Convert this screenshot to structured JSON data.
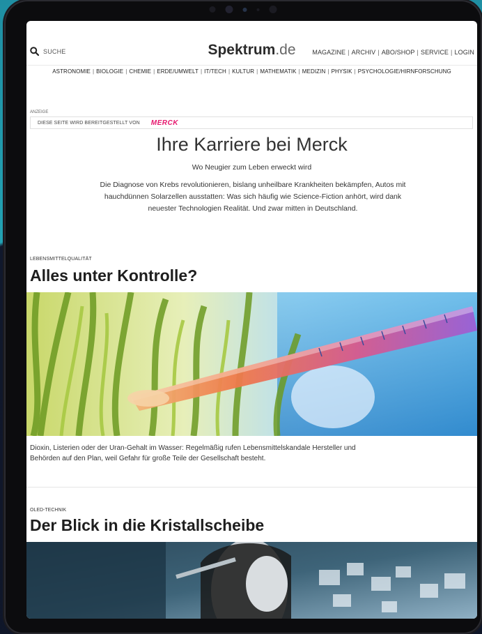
{
  "header": {
    "search_label": "SUCHE",
    "logo_main": "Spektrum",
    "logo_suffix": ".de",
    "top_nav": [
      "MAGAZINE",
      "ARCHIV",
      "ABO/SHOP",
      "SERVICE",
      "LOGIN"
    ],
    "categories": [
      "ASTRONOMIE",
      "BIOLOGIE",
      "CHEMIE",
      "ERDE/UMWELT",
      "IT/TECH",
      "KULTUR",
      "MATHEMATIK",
      "MEDIZIN",
      "PHYSIK",
      "PSYCHOLOGIE/HIRNFORSCHUNG"
    ]
  },
  "ad": {
    "label": "ANZEIGE",
    "sponsor_text": "DIESE SEITE WIRD BEREITGESTELLT VON",
    "sponsor_logo": "MERCK",
    "title": "Ihre Karriere bei Merck",
    "subtitle": "Wo Neugier zum Leben erweckt wird",
    "body": "Die Diagnose von Krebs revolutionieren, bislang unheilbare Krankheiten bekämpfen, Autos mit hauchdünnen Solarzellen ausstatten: Was sich häufig wie Science-Fiction anhört, wird dank neuester Technologien Realität. Und zwar mitten in Deutschland."
  },
  "articles": [
    {
      "category": "LEBENSMITTELQUALITÄT",
      "title": "Alles unter Kontrolle?",
      "teaser": "Dioxin, Listerien oder der Uran-Gehalt im Wasser: Regelmäßig rufen Lebensmittelskandale Hersteller und Behörden auf den Plan, weil Gefahr für große Teile der Gesellschaft besteht."
    },
    {
      "category": "OLED-TECHNIK",
      "title": "Der Blick in die Kristallscheibe"
    }
  ],
  "colors": {
    "merck_pink": "#e6186e",
    "frame_teal": "#23a3b4"
  }
}
